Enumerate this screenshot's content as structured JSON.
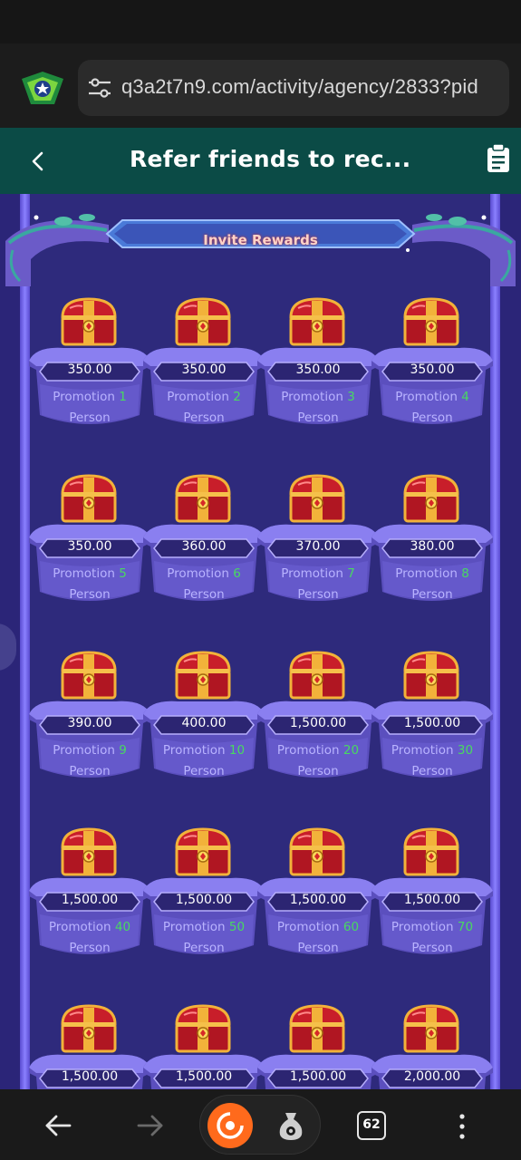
{
  "browser": {
    "url": "q3a2t7n9.com/activity/agency/2833?pid",
    "tab_count": "62"
  },
  "header": {
    "title": "Refer friends to rec..."
  },
  "banner": {
    "title": "Invite Rewards"
  },
  "rewards": [
    {
      "amount": "350.00",
      "label": "Promotion",
      "count": "1",
      "unit": "Person"
    },
    {
      "amount": "350.00",
      "label": "Promotion",
      "count": "2",
      "unit": "Person"
    },
    {
      "amount": "350.00",
      "label": "Promotion",
      "count": "3",
      "unit": "Person"
    },
    {
      "amount": "350.00",
      "label": "Promotion",
      "count": "4",
      "unit": "Person"
    },
    {
      "amount": "350.00",
      "label": "Promotion",
      "count": "5",
      "unit": "Person"
    },
    {
      "amount": "360.00",
      "label": "Promotion",
      "count": "6",
      "unit": "Person"
    },
    {
      "amount": "370.00",
      "label": "Promotion",
      "count": "7",
      "unit": "Person"
    },
    {
      "amount": "380.00",
      "label": "Promotion",
      "count": "8",
      "unit": "Person"
    },
    {
      "amount": "390.00",
      "label": "Promotion",
      "count": "9",
      "unit": "Person"
    },
    {
      "amount": "400.00",
      "label": "Promotion",
      "count": "10",
      "unit": "Person"
    },
    {
      "amount": "1,500.00",
      "label": "Promotion",
      "count": "20",
      "unit": "Person"
    },
    {
      "amount": "1,500.00",
      "label": "Promotion",
      "count": "30",
      "unit": "Person"
    },
    {
      "amount": "1,500.00",
      "label": "Promotion",
      "count": "40",
      "unit": "Person"
    },
    {
      "amount": "1,500.00",
      "label": "Promotion",
      "count": "50",
      "unit": "Person"
    },
    {
      "amount": "1,500.00",
      "label": "Promotion",
      "count": "60",
      "unit": "Person"
    },
    {
      "amount": "1,500.00",
      "label": "Promotion",
      "count": "70",
      "unit": "Person"
    },
    {
      "amount": "1,500.00"
    },
    {
      "amount": "1,500.00"
    },
    {
      "amount": "1,500.00"
    },
    {
      "amount": "2,000.00"
    }
  ],
  "icons": {
    "site": "site-logo-icon",
    "tune": "tune-icon",
    "back": "back-arrow-icon",
    "clipboard": "clipboard-icon",
    "chest": "treasure-chest-icon"
  },
  "colors": {
    "header": "#0b4b46",
    "stage": "#2e2a7c",
    "count_highlight": "#49d861",
    "label_text": "#b9b3ff"
  }
}
